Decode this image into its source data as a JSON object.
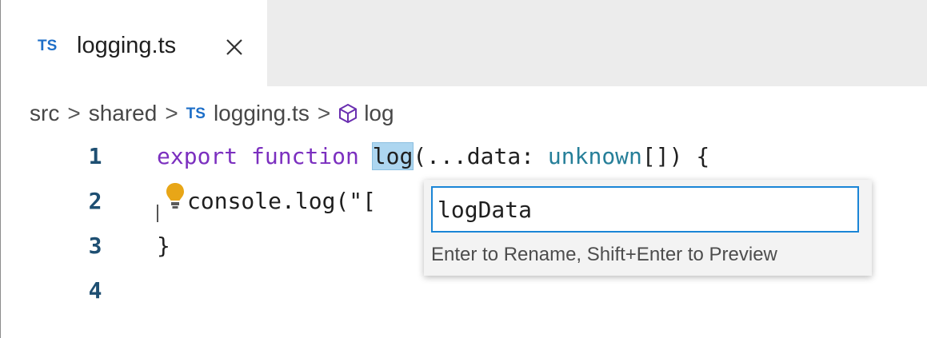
{
  "tab": {
    "language_badge": "TS",
    "title": "logging.ts",
    "close_icon": "close-icon"
  },
  "breadcrumb": {
    "items": [
      "src",
      "shared",
      "logging.ts",
      "log"
    ],
    "separator": ">",
    "file_badge": "TS",
    "symbol_icon": "symbol-method-icon"
  },
  "editor": {
    "line_numbers": [
      "1",
      "2",
      "3",
      "4"
    ],
    "lines": [
      {
        "keyword1": "export",
        "keyword2": "function",
        "fn_name": "log",
        "params_start": "(...data: ",
        "type": "unknown",
        "params_end": "[]) {"
      },
      {
        "text": "console.log(\"["
      },
      {
        "text": "}"
      },
      {
        "text": ""
      }
    ],
    "lightbulb_icon": "lightbulb-icon"
  },
  "rename_widget": {
    "input_value": "logData",
    "hint": "Enter to Rename, Shift+Enter to Preview"
  },
  "colors": {
    "keyword": "#7b2fbf",
    "type": "#267f99",
    "line_number": "#1e4f72",
    "ts_badge": "#1e6fc8",
    "input_border": "#1a85d6",
    "symbol_highlight": "#add6f0",
    "lightbulb": "#e8a617"
  }
}
